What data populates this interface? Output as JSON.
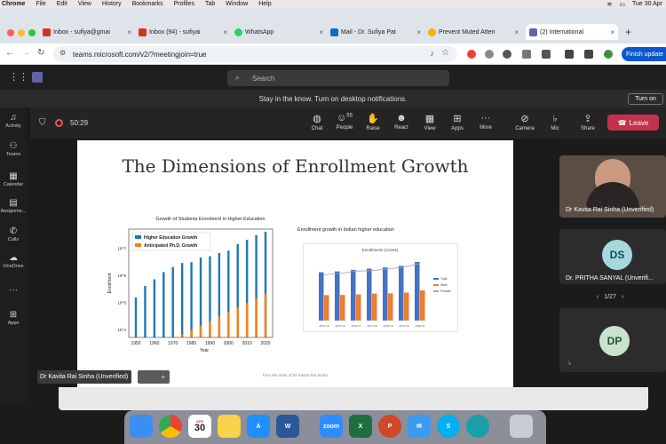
{
  "menubar": {
    "app": "Chrome",
    "items": [
      "File",
      "Edit",
      "View",
      "History",
      "Bookmarks",
      "Profiles",
      "Tab",
      "Window",
      "Help"
    ],
    "clock": "Tue 30 Apr"
  },
  "tabs": [
    {
      "label": "Inbox - sufiya@gmai",
      "icon_color": "#d93025"
    },
    {
      "label": "Inbox (94) - sufiyai",
      "icon_color": "#d93025"
    },
    {
      "label": "WhatsApp",
      "icon_color": "#25d366"
    },
    {
      "label": "Mail - Dr. Sufiya Pat",
      "icon_color": "#0f6cbd"
    },
    {
      "label": "Prevent Muted Atten",
      "icon_color": "#f4b400"
    },
    {
      "label": "(2) International",
      "icon_color": "#6264a7",
      "active": true
    }
  ],
  "address": {
    "url": "teams.microsoft.com/v2/?meetingjoin=true",
    "finish_update": "Finish update"
  },
  "teams": {
    "search_placeholder": "Search"
  },
  "notification": {
    "text": "Stay in the know. Turn on desktop notifications.",
    "button": "Turn on"
  },
  "rail": [
    "Activity",
    "Teams",
    "Calendar",
    "Assignme...",
    "Calls",
    "OneDrive",
    "Apps"
  ],
  "meeting": {
    "timer": "50:29",
    "controls": [
      {
        "label": "Chat",
        "icon": "chat-icon"
      },
      {
        "label": "People",
        "icon": "people-icon",
        "badge": "55"
      },
      {
        "label": "Raise",
        "icon": "hand-icon"
      },
      {
        "label": "React",
        "icon": "smile-icon"
      },
      {
        "label": "View",
        "icon": "grid-icon"
      },
      {
        "label": "Apps",
        "icon": "apps-icon"
      },
      {
        "label": "More",
        "icon": "more-icon"
      },
      {
        "label": "Camera",
        "icon": "camera-off-icon"
      },
      {
        "label": "Mic",
        "icon": "mic-off-icon"
      },
      {
        "label": "Share",
        "icon": "share-icon"
      }
    ],
    "leave": "Leave"
  },
  "slide": {
    "title": "The Dimensions of Enrollment Growth",
    "from_desk": "from the desk of Dr Kavita Rai Sinha",
    "presenter_label": "Dr Kavita Rai Sinha (Unverified)"
  },
  "chart_data": [
    {
      "type": "bar",
      "title": "Growth of Students Enrolment in Higher Education",
      "xlabel": "Year",
      "ylabel": "Enrolment",
      "yscale": "log",
      "ytick_labels": [
        "10^4",
        "10^5",
        "10^6",
        "10^7"
      ],
      "categories": [
        "1950",
        "1960",
        "1970",
        "1980",
        "1990",
        "2000",
        "2010",
        "2020"
      ],
      "x": [
        1950,
        1955,
        1960,
        1965,
        1970,
        1975,
        1980,
        1985,
        1990,
        1995,
        2000,
        2005,
        2010,
        2015,
        2020
      ],
      "series": [
        {
          "name": "Higher Education Growth",
          "color": "#1f77b4",
          "values": [
            150000,
            400000,
            700000,
            1300000,
            2000000,
            2800000,
            3000000,
            4500000,
            5000000,
            6500000,
            8000000,
            14000000,
            20000000,
            30000000,
            40000000
          ]
        },
        {
          "name": "Anticipated Ph.D. Growth",
          "color": "#ff7f0e",
          "values": null
        }
      ]
    },
    {
      "type": "bar",
      "title": "Enrollment growth in Indian higher education",
      "subtitle": "Enrollments (crores)",
      "categories": [
        "2014-15",
        "2015-16",
        "2016-17",
        "2017-18",
        "2018-19",
        "2019-20",
        "2020-21"
      ],
      "series": [
        {
          "name": "Total",
          "color": "#4472c4",
          "values": [
            3.4,
            3.46,
            3.57,
            3.66,
            3.74,
            3.85,
            4.13
          ]
        },
        {
          "name": "Male",
          "color": "#ed7d31",
          "values": [
            1.79,
            1.8,
            1.84,
            1.9,
            1.92,
            1.97,
            2.12
          ]
        },
        {
          "name": "Female",
          "color": "#a5a5a5",
          "values": [
            1.61,
            1.66,
            1.74,
            1.76,
            1.82,
            1.88,
            2.01
          ]
        }
      ]
    }
  ],
  "participants": [
    {
      "name": "Dr Kavita Rai Sinha (Unverified)",
      "video": true
    },
    {
      "name": "Dr. PRITHA SANYAL (Unverifi...",
      "initials": "DS",
      "avatar_color": "#a6d8de"
    },
    {
      "initials": "DP",
      "avatar_color": "#c9e3cf"
    }
  ],
  "pager": {
    "text": "1/27"
  },
  "dock": [
    {
      "label": "Finder",
      "color": "#3b8ff3"
    },
    {
      "label": "Chrome",
      "color": "#fff"
    },
    {
      "label": "30",
      "color": "#fff",
      "sub": "APR"
    },
    {
      "label": "Notes",
      "color": "#f7d24a"
    },
    {
      "label": "App Store",
      "color": "#1e90ff"
    },
    {
      "label": "W",
      "color": "#2b579a"
    },
    {
      "label": "zoom",
      "color": "#2d8cff"
    },
    {
      "label": "X",
      "color": "#1d6f42"
    },
    {
      "label": "P",
      "color": "#d24726"
    },
    {
      "label": "Mail",
      "color": "#3a9bf0"
    },
    {
      "label": "S",
      "color": "#00aff0"
    },
    {
      "label": "Edge",
      "color": "#1aa0a8"
    },
    {
      "label": "Trash",
      "color": "#c9ccd2"
    }
  ]
}
